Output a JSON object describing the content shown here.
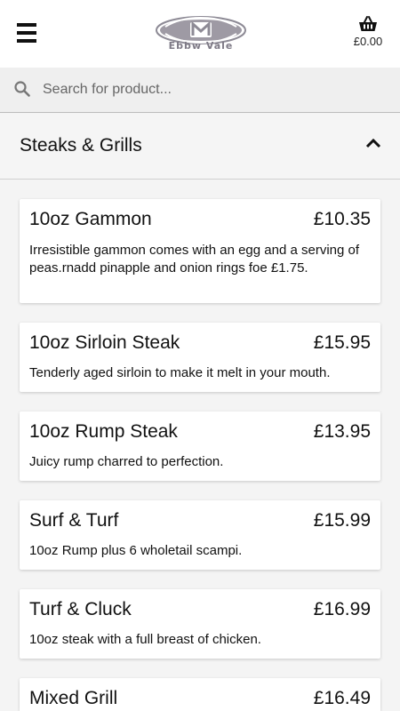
{
  "header": {
    "logo_text": "Ebbw Vale",
    "basket_total": "£0.00"
  },
  "search": {
    "placeholder": "Search for product..."
  },
  "category": {
    "title": "Steaks & Grills"
  },
  "items": [
    {
      "name": "10oz Gammon",
      "price": "£10.35",
      "description": "Irresistible gammon comes with an egg and a serving of peas.rnadd pinapple and onion rings foe £1.75."
    },
    {
      "name": "10oz Sirloin Steak",
      "price": "£15.95",
      "description": "Tenderly aged sirloin to make it melt in your mouth."
    },
    {
      "name": "10oz Rump Steak",
      "price": "£13.95",
      "description": "Juicy rump charred to perfection."
    },
    {
      "name": "Surf & Turf",
      "price": "£15.99",
      "description": "10oz Rump plus 6 wholetail scampi."
    },
    {
      "name": "Turf & Cluck",
      "price": "£16.99",
      "description": "10oz steak with a full breast of chicken."
    },
    {
      "name": "Mixed Grill",
      "price": "£16.49",
      "description": ""
    }
  ]
}
